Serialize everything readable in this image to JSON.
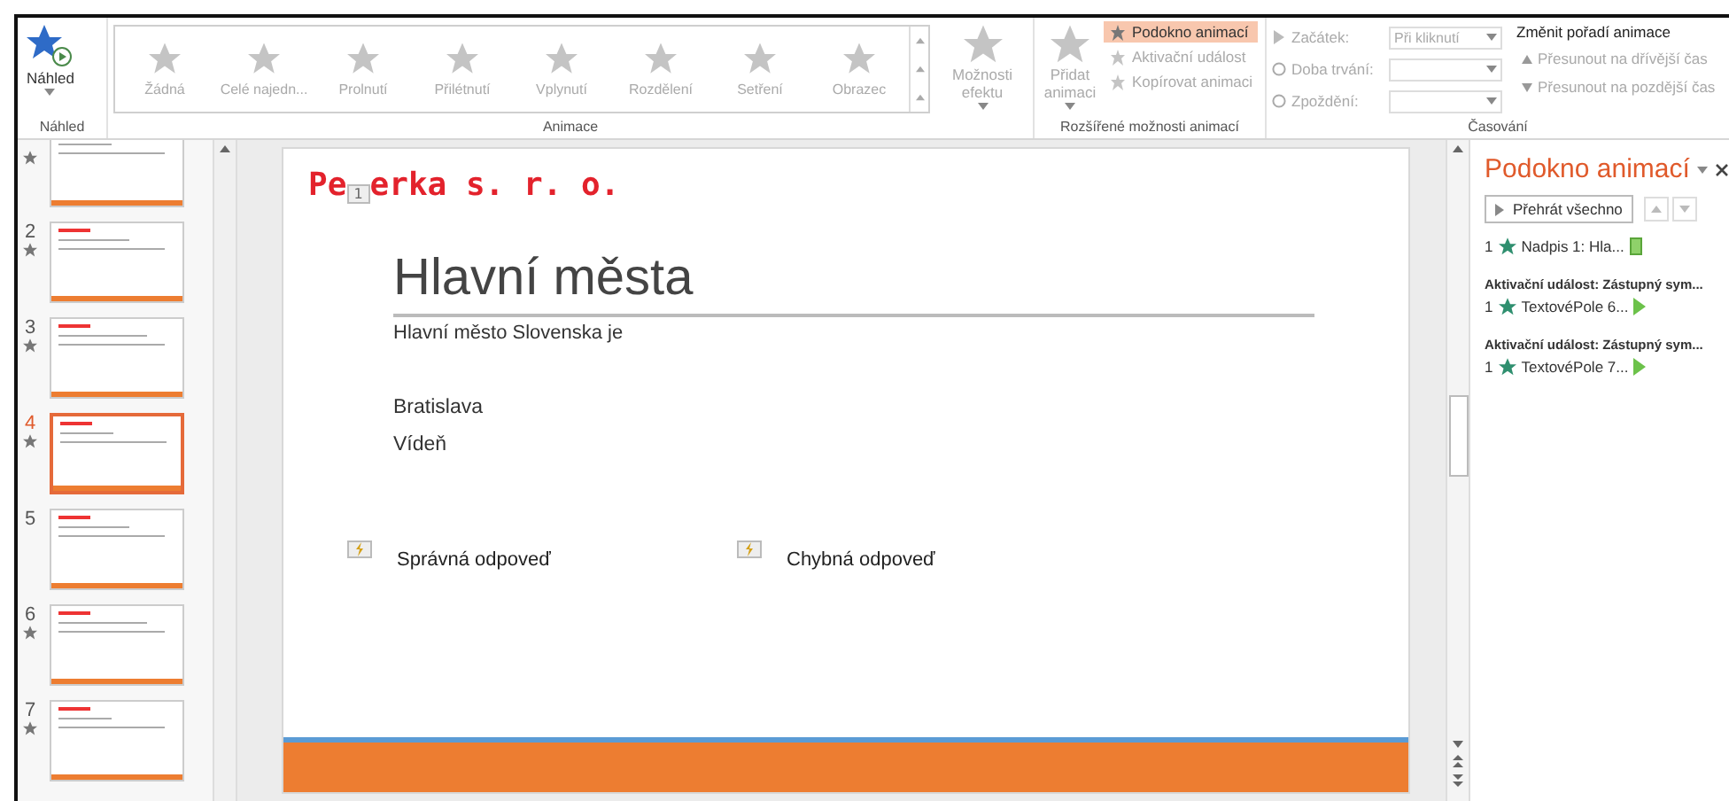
{
  "ribbon": {
    "preview": {
      "label": "Náhled",
      "group": "Náhled"
    },
    "animations": {
      "group": "Animace",
      "effect_options": {
        "label": "Možnosti efektu",
        "disabled": true
      },
      "items": [
        {
          "label": "Žádná",
          "disabled": true
        },
        {
          "label": "Celé najedn...",
          "disabled": true
        },
        {
          "label": "Prolnutí",
          "disabled": true
        },
        {
          "label": "Přilétnutí",
          "disabled": true
        },
        {
          "label": "Vplynutí",
          "disabled": true
        },
        {
          "label": "Rozdělení",
          "disabled": true
        },
        {
          "label": "Setření",
          "disabled": true
        },
        {
          "label": "Obrazec",
          "disabled": true
        }
      ]
    },
    "advanced": {
      "group": "Rozšířené možnosti animací",
      "add_animation": {
        "label": "Přidat animaci",
        "disabled": true
      },
      "commands": [
        {
          "label": "Podokno animací",
          "selected": true,
          "disabled": false
        },
        {
          "label": "Aktivační událost",
          "selected": false,
          "disabled": true
        },
        {
          "label": "Kopírovat animaci",
          "selected": false,
          "disabled": true
        }
      ]
    },
    "timing": {
      "group": "Časování",
      "start": {
        "label": "Začátek:",
        "value": "Při kliknutí",
        "disabled": true
      },
      "duration": {
        "label": "Doba trvání:",
        "disabled": true
      },
      "delay": {
        "label": "Zpoždění:",
        "disabled": true
      },
      "reorder": {
        "title": "Změnit pořadí animace",
        "commands": [
          {
            "label": "Přesunout na dřívější čas",
            "kind": "earlier",
            "disabled": true
          },
          {
            "label": "Přesunout na pozdější čas",
            "kind": "later",
            "disabled": true
          }
        ]
      }
    }
  },
  "slides": [
    {
      "animated": true,
      "selected": false
    },
    {
      "number": "2",
      "animated": true,
      "selected": false
    },
    {
      "number": "3",
      "animated": true,
      "selected": false
    },
    {
      "number": "4",
      "animated": true,
      "selected": true
    },
    {
      "number": "5",
      "animated": false,
      "selected": false
    },
    {
      "number": "6",
      "animated": true,
      "selected": false
    },
    {
      "number": "7",
      "animated": true,
      "selected": false
    }
  ],
  "slide": {
    "logo_before": "Pe",
    "animation_badge": "1",
    "logo_after": "erka s. r. o.",
    "title": "Hlavní města",
    "subtitle": "Hlavní město Slovenska je",
    "lines": [
      "Bratislava",
      "Vídeň"
    ],
    "answers": [
      "Správná odpoveď",
      "Chybná odpoveď"
    ]
  },
  "animation_pane": {
    "title": "Podokno animací",
    "play_all": "Přehrát všechno",
    "entries": [
      {
        "order": "1",
        "name": "Nadpis 1: Hla...",
        "kind": "rectangle"
      },
      {
        "trigger": "Aktivační událost: Zástupný sym...",
        "order": "1",
        "name": "TextovéPole 6...",
        "kind": "triangle"
      },
      {
        "trigger": "Aktivační událost: Zástupný sym...",
        "order": "1",
        "name": "TextovéPole 7...",
        "kind": "triangle"
      }
    ]
  }
}
